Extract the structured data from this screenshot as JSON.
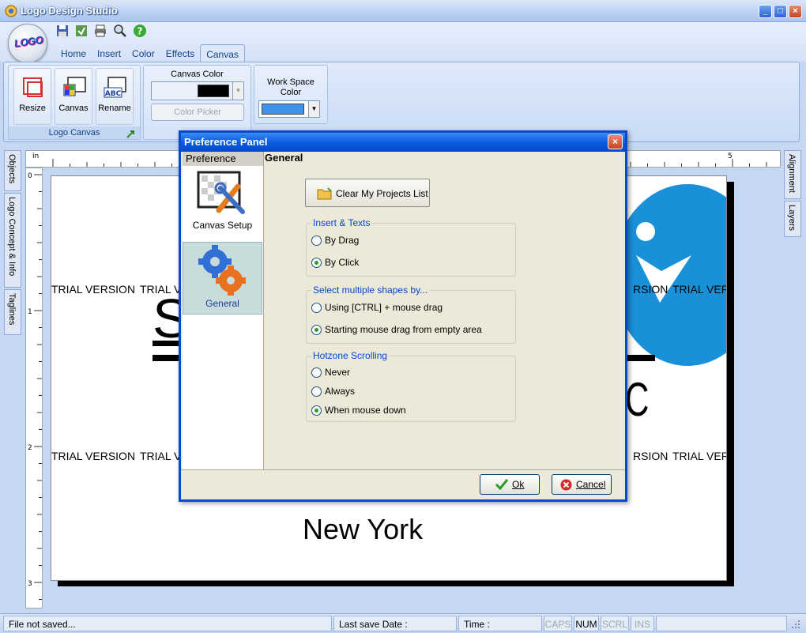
{
  "window": {
    "title": "Logo Design Studio",
    "orb_text": "LOGO"
  },
  "tabs": [
    "Home",
    "Insert",
    "Color",
    "Effects",
    "Canvas"
  ],
  "ribbon": {
    "logo_canvas_group": {
      "label": "Logo Canvas",
      "buttons": [
        "Resize",
        "Canvas",
        "Rename"
      ],
      "rename_icon_text": "ABC"
    },
    "canvas_color": {
      "label": "Canvas Color",
      "swatch": "#000000",
      "picker_label": "Color Picker"
    },
    "workspace_color": {
      "label_line1": "Work Space",
      "label_line2": "Color",
      "swatch": "#3f93ea"
    }
  },
  "side_tabs_left": [
    "Objects",
    "Logo Concept & Info",
    "Taglines"
  ],
  "side_tabs_right": [
    "Alignment",
    "Layers"
  ],
  "ruler": {
    "unit": "in",
    "top_marks": [
      "5"
    ],
    "left_marks": [
      "0",
      "1",
      "2",
      "3"
    ]
  },
  "canvas": {
    "watermark": "TRIAL VERSION",
    "watermark_partial_a": "TRIAL V",
    "watermark_partial_b": "RSION",
    "watermark_partial_c": "TRIAL VER",
    "city": "New York",
    "big_letter_left": "S",
    "big_letter_right": "C",
    "accent_blue": "#1a90d9"
  },
  "dialog": {
    "title": "Preference Panel",
    "nav_header": "Preference",
    "nav_items": [
      "Canvas Setup",
      "General"
    ],
    "section_title": "General",
    "clear_button": "Clear My Projects List",
    "groups": [
      {
        "legend": "Insert  & Texts",
        "options": [
          "By Drag",
          "By Click"
        ],
        "selected": 1
      },
      {
        "legend": "Select multiple shapes by...",
        "options": [
          "Using [CTRL] + mouse drag",
          "Starting mouse drag from empty area"
        ],
        "selected": 1
      },
      {
        "legend": "Hotzone Scrolling",
        "options": [
          "Never",
          "Always",
          "When mouse down"
        ],
        "selected": 2
      }
    ],
    "ok": "Ok",
    "cancel": "Cancel"
  },
  "status": {
    "file": "File not saved...",
    "last_save": "Last save Date :",
    "time": "Time :",
    "caps": "CAPS",
    "num": "NUM",
    "scrl": "SCRL",
    "ins": "INS"
  }
}
